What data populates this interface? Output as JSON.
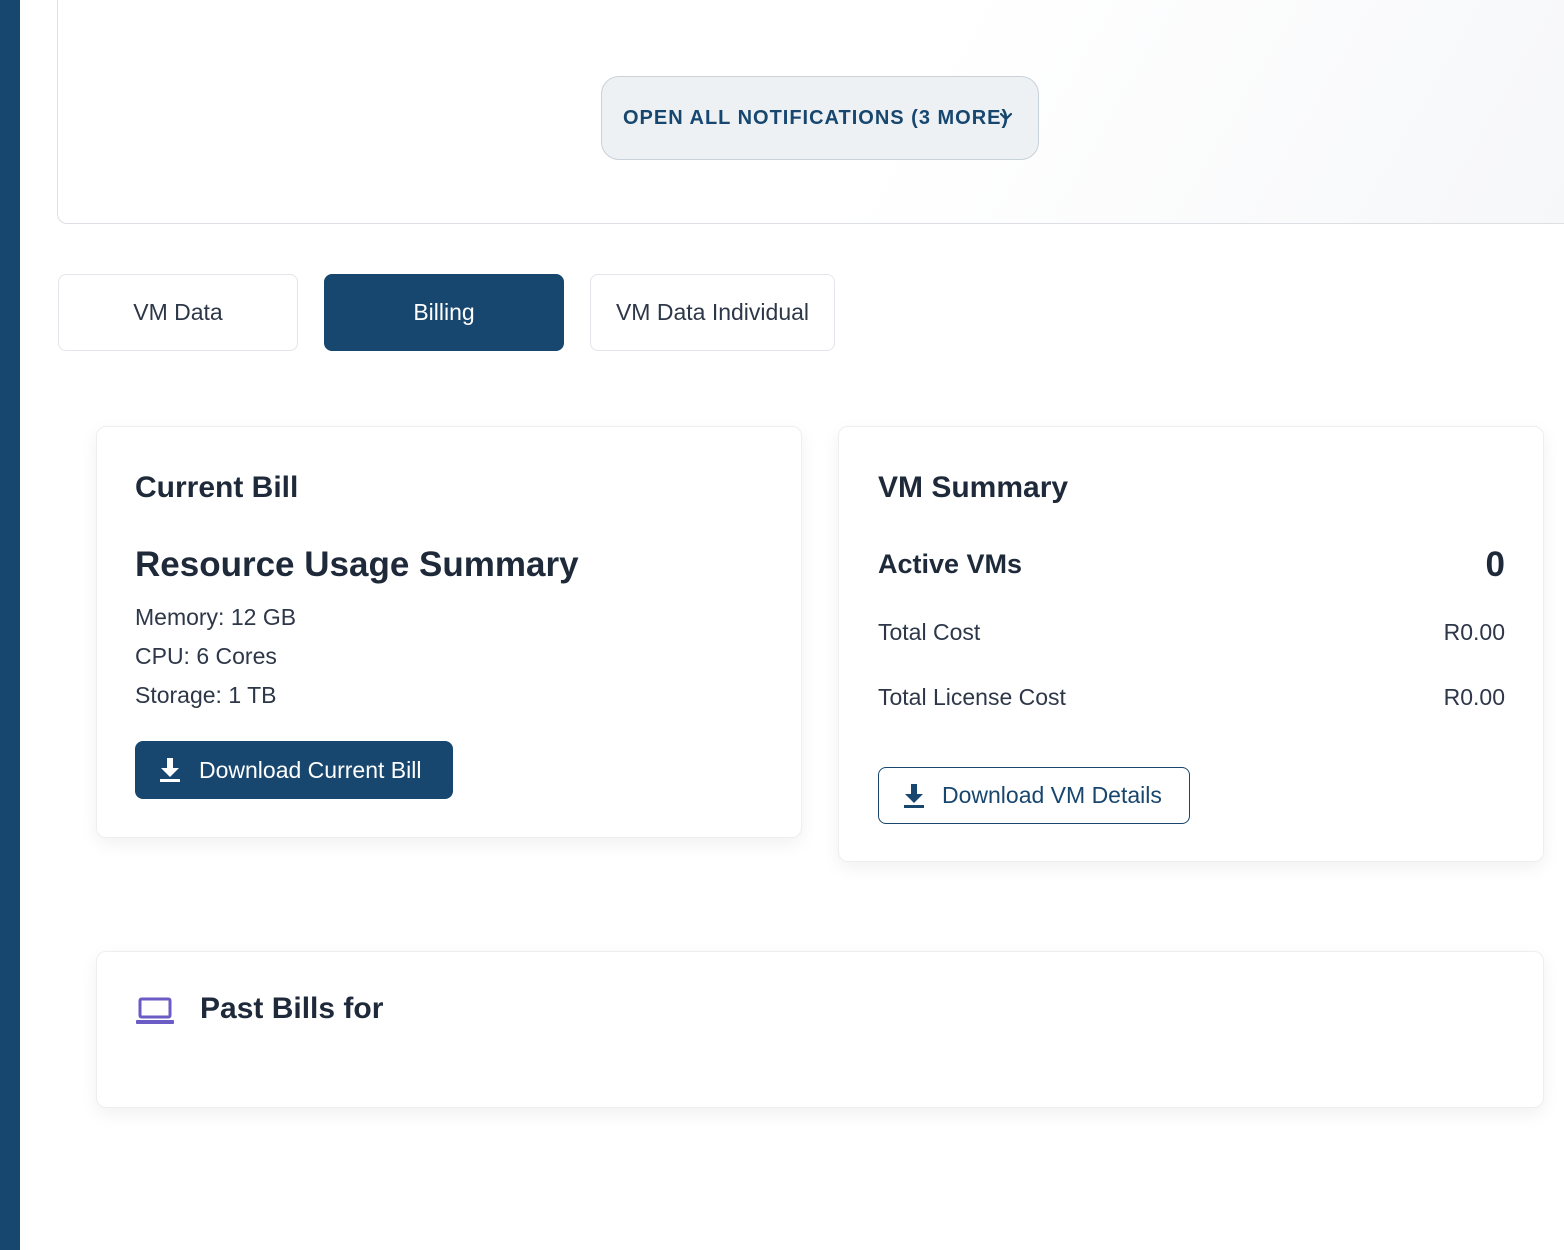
{
  "notifications": {
    "open_all_label": "OPEN ALL NOTIFICATIONS (3 MORE)"
  },
  "tabs": [
    {
      "label": "VM Data",
      "active": false
    },
    {
      "label": "Billing",
      "active": true
    },
    {
      "label": "VM Data Individual",
      "active": false
    }
  ],
  "current_bill": {
    "title": "Current Bill",
    "subtitle": "Resource Usage Summary",
    "memory": "Memory: 12 GB",
    "cpu": "CPU: 6 Cores",
    "storage": "Storage: 1 TB",
    "download_label": "Download Current Bill"
  },
  "vm_summary": {
    "title": "VM Summary",
    "active_vms_label": "Active VMs",
    "active_vms_value": "0",
    "total_cost_label": "Total Cost",
    "total_cost_value": "R0.00",
    "total_license_cost_label": "Total License Cost",
    "total_license_cost_value": "R0.00",
    "download_label": "Download VM Details"
  },
  "past_bills": {
    "title": "Past Bills for"
  },
  "colors": {
    "primary": "#17466e",
    "icon_accent": "#6b5bc4"
  },
  "icons": {
    "chevron": "chevron-down-icon",
    "download": "download-icon",
    "laptop": "laptop-icon"
  }
}
